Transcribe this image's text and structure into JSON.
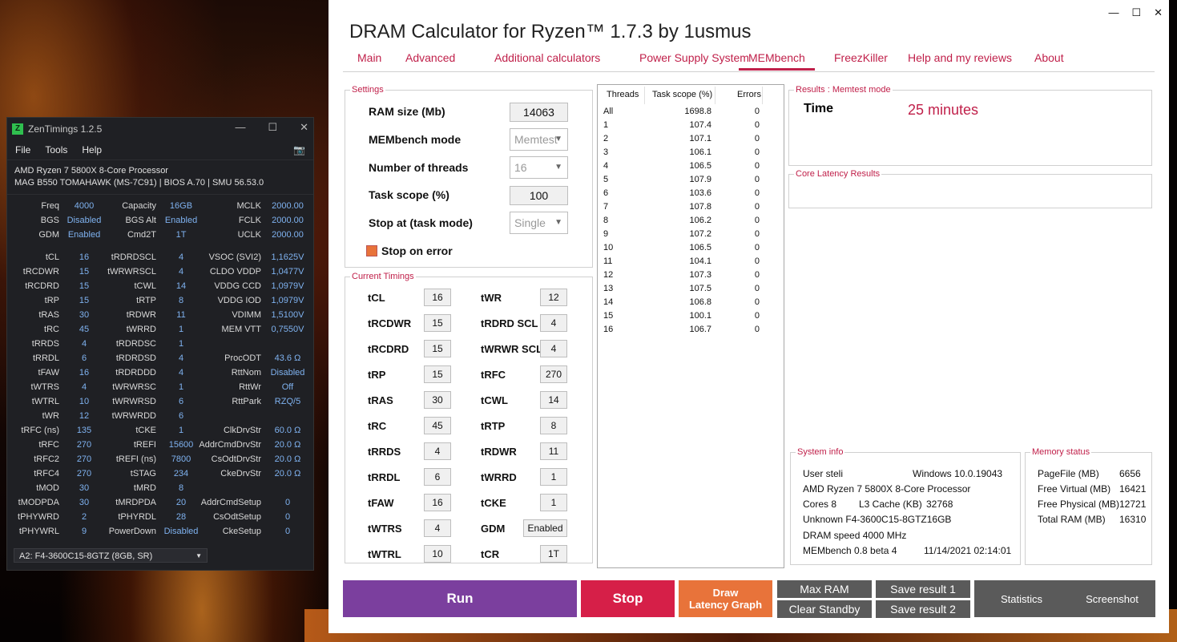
{
  "zentimings": {
    "title": "ZenTimings 1.2.5",
    "logo": "Z",
    "menu": [
      "File",
      "Tools",
      "Help"
    ],
    "cpu": "AMD Ryzen 7 5800X 8-Core Processor",
    "board": "MAG B550 TOMAHAWK (MS-7C91) | BIOS A.70 | SMU 56.53.0",
    "rows": [
      [
        [
          "Freq",
          "4000"
        ],
        [
          "Capacity",
          "16GB"
        ],
        [
          "MCLK",
          "2000.00"
        ]
      ],
      [
        [
          "BGS",
          "Disabled"
        ],
        [
          "BGS Alt",
          "Enabled"
        ],
        [
          "FCLK",
          "2000.00"
        ]
      ],
      [
        [
          "GDM",
          "Enabled"
        ],
        [
          "Cmd2T",
          "1T"
        ],
        [
          "UCLK",
          "2000.00"
        ]
      ],
      "gap",
      [
        [
          "tCL",
          "16"
        ],
        [
          "tRDRDSCL",
          "4"
        ],
        [
          "VSOC (SVI2)",
          "1,1625V"
        ]
      ],
      [
        [
          "tRCDWR",
          "15"
        ],
        [
          "tWRWRSCL",
          "4"
        ],
        [
          "CLDO VDDP",
          "1,0477V"
        ]
      ],
      [
        [
          "tRCDRD",
          "15"
        ],
        [
          "tCWL",
          "14"
        ],
        [
          "VDDG CCD",
          "1,0979V"
        ]
      ],
      [
        [
          "tRP",
          "15"
        ],
        [
          "tRTP",
          "8"
        ],
        [
          "VDDG IOD",
          "1,0979V"
        ]
      ],
      [
        [
          "tRAS",
          "30"
        ],
        [
          "tRDWR",
          "11"
        ],
        [
          "VDIMM",
          "1,5100V"
        ]
      ],
      [
        [
          "tRC",
          "45"
        ],
        [
          "tWRRD",
          "1"
        ],
        [
          "MEM VTT",
          "0,7550V"
        ]
      ],
      [
        [
          "tRRDS",
          "4"
        ],
        [
          "tRDRDSC",
          "1"
        ],
        [
          "",
          ""
        ]
      ],
      [
        [
          "tRRDL",
          "6"
        ],
        [
          "tRDRDSD",
          "4"
        ],
        [
          "ProcODT",
          "43.6 Ω"
        ]
      ],
      [
        [
          "tFAW",
          "16"
        ],
        [
          "tRDRDDD",
          "4"
        ],
        [
          "RttNom",
          "Disabled"
        ]
      ],
      [
        [
          "tWTRS",
          "4"
        ],
        [
          "tWRWRSC",
          "1"
        ],
        [
          "RttWr",
          "Off"
        ]
      ],
      [
        [
          "tWTRL",
          "10"
        ],
        [
          "tWRWRSD",
          "6"
        ],
        [
          "RttPark",
          "RZQ/5"
        ]
      ],
      [
        [
          "tWR",
          "12"
        ],
        [
          "tWRWRDD",
          "6"
        ],
        [
          "",
          ""
        ]
      ],
      [
        [
          "tRFC (ns)",
          "135"
        ],
        [
          "tCKE",
          "1"
        ],
        [
          "ClkDrvStr",
          "60.0 Ω"
        ]
      ],
      [
        [
          "tRFC",
          "270"
        ],
        [
          "tREFI",
          "15600"
        ],
        [
          "AddrCmdDrvStr",
          "20.0 Ω"
        ]
      ],
      [
        [
          "tRFC2",
          "270"
        ],
        [
          "tREFI (ns)",
          "7800"
        ],
        [
          "CsOdtDrvStr",
          "20.0 Ω"
        ]
      ],
      [
        [
          "tRFC4",
          "270"
        ],
        [
          "tSTAG",
          "234"
        ],
        [
          "CkeDrvStr",
          "20.0 Ω"
        ]
      ],
      [
        [
          "tMOD",
          "30"
        ],
        [
          "tMRD",
          "8"
        ],
        [
          "",
          ""
        ]
      ],
      [
        [
          "tMODPDA",
          "30"
        ],
        [
          "tMRDPDA",
          "20"
        ],
        [
          "AddrCmdSetup",
          "0"
        ]
      ],
      [
        [
          "tPHYWRD",
          "2"
        ],
        [
          "tPHYRDL",
          "28"
        ],
        [
          "CsOdtSetup",
          "0"
        ]
      ],
      [
        [
          "tPHYWRL",
          "9"
        ],
        [
          "PowerDown",
          "Disabled"
        ],
        [
          "CkeSetup",
          "0"
        ]
      ]
    ],
    "module": "A2: F4-3600C15-8GTZ (8GB, SR)"
  },
  "dram": {
    "title": "DRAM Calculator for Ryzen™ 1.7.3 by 1usmus",
    "tabs": [
      "Main",
      "Advanced",
      "Additional calculators",
      "Power Supply System",
      "MEMbench",
      "FreezKiller",
      "Help and my reviews",
      "About"
    ],
    "settings": {
      "title": "Settings",
      "ram_size_label": "RAM size (Mb)",
      "ram_size": "14063",
      "mode_label": "MEMbench mode",
      "mode": "Memtest",
      "threads_label": "Number of threads",
      "threads": "16",
      "scope_label": "Task scope (%)",
      "scope": "100",
      "stop_label": "Stop at (task mode)",
      "stop": "Single",
      "stop_err_label": "Stop on error"
    },
    "timings_title": "Current Timings",
    "timings": [
      [
        [
          "tCL",
          "16"
        ],
        [
          "tWR",
          "12"
        ]
      ],
      [
        [
          "tRCDWR",
          "15"
        ],
        [
          "tRDRD SCL",
          "4"
        ]
      ],
      [
        [
          "tRCDRD",
          "15"
        ],
        [
          "tWRWR SCL",
          "4"
        ]
      ],
      [
        [
          "tRP",
          "15"
        ],
        [
          "tRFC",
          "270"
        ]
      ],
      [
        [
          "tRAS",
          "30"
        ],
        [
          "tCWL",
          "14"
        ]
      ],
      [
        [
          "tRC",
          "45"
        ],
        [
          "tRTP",
          "8"
        ]
      ],
      [
        [
          "tRRDS",
          "4"
        ],
        [
          "tRDWR",
          "11"
        ]
      ],
      [
        [
          "tRRDL",
          "6"
        ],
        [
          "tWRRD",
          "1"
        ]
      ],
      [
        [
          "tFAW",
          "16"
        ],
        [
          "tCKE",
          "1"
        ]
      ],
      [
        [
          "tWTRS",
          "4"
        ],
        [
          "GDM",
          "Enabled"
        ]
      ],
      [
        [
          "tWTRL",
          "10"
        ],
        [
          "tCR",
          "1T"
        ]
      ]
    ],
    "bench_table": {
      "headers": [
        "Threads",
        "Task scope (%)",
        "Errors"
      ],
      "rows": [
        [
          "All",
          "1698.8",
          "0"
        ],
        [
          "1",
          "107.4",
          "0"
        ],
        [
          "2",
          "107.1",
          "0"
        ],
        [
          "3",
          "106.1",
          "0"
        ],
        [
          "4",
          "106.5",
          "0"
        ],
        [
          "5",
          "107.9",
          "0"
        ],
        [
          "6",
          "103.6",
          "0"
        ],
        [
          "7",
          "107.8",
          "0"
        ],
        [
          "8",
          "106.2",
          "0"
        ],
        [
          "9",
          "107.2",
          "0"
        ],
        [
          "10",
          "106.5",
          "0"
        ],
        [
          "11",
          "104.1",
          "0"
        ],
        [
          "12",
          "107.3",
          "0"
        ],
        [
          "13",
          "107.5",
          "0"
        ],
        [
          "14",
          "106.8",
          "0"
        ],
        [
          "15",
          "100.1",
          "0"
        ],
        [
          "16",
          "106.7",
          "0"
        ]
      ]
    },
    "results": {
      "title": "Results : Memtest mode",
      "time_label": "Time",
      "time_value": "25 minutes"
    },
    "latency_title": "Core Latency Results",
    "sysinfo": {
      "title": "System info",
      "user": "User steli",
      "os": "Windows 10.0.19043",
      "cpu": "AMD Ryzen 7 5800X 8-Core Processor",
      "cores": "Cores 8",
      "l3_label": "L3 Cache (KB)",
      "l3": "32768",
      "mem": "Unknown F4-3600C15-8GTZ16GB",
      "speed": "DRAM speed 4000 MHz",
      "version": "MEMbench 0.8 beta 4",
      "date": "11/14/2021 02:14:01"
    },
    "memstatus": {
      "title": "Memory status",
      "rows": [
        [
          "PageFile (MB)",
          "6656"
        ],
        [
          "Free Virtual (MB)",
          "16421"
        ],
        [
          "Free Physical (MB)",
          "12721"
        ],
        [
          "Total RAM (MB)",
          "16310"
        ]
      ]
    },
    "buttons": {
      "run": "Run",
      "stop": "Stop",
      "draw1": "Draw",
      "draw2": "Latency Graph",
      "maxram": "Max RAM",
      "clear": "Clear Standby",
      "save1": "Save result 1",
      "save2": "Save result 2",
      "stats": "Statistics",
      "shot": "Screenshot"
    },
    "colors": {
      "accent": "#c0204a",
      "run": "#7b3f9e",
      "stop": "#d61f48",
      "draw": "#e8733a",
      "gray": "#5a5a5a"
    }
  }
}
